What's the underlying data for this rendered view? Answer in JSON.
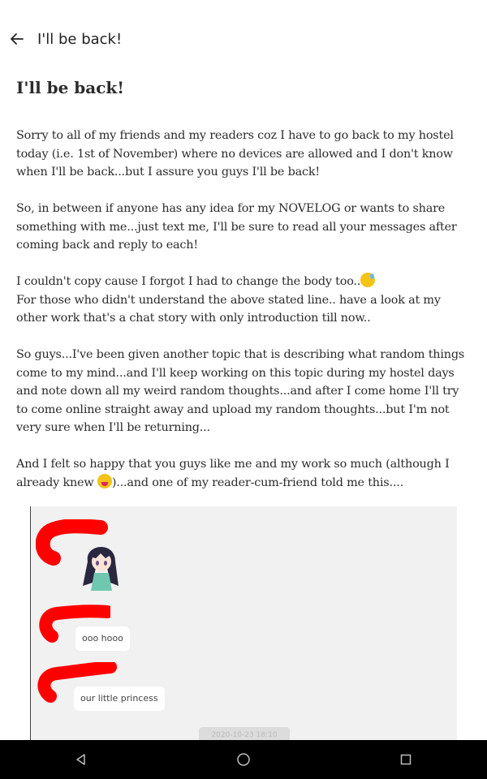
{
  "appbar": {
    "title": "I'll be back!",
    "back_icon": "arrow-left-icon"
  },
  "story": {
    "title": "I'll be back!",
    "paragraphs": [
      "Sorry to all of my friends and my readers coz I have to go back to my hostel today (i.e. 1st of November) where no devices are allowed and I don't know when I'll be back...but I assure you guys I'll be back!",
      "So, in between if anyone has any idea for my NOVELOG or wants to share something with me...just text me, I'll be sure to read all your messages after coming back and reply to each!",
      "I couldn't copy cause I forgot I had to change the body too..",
      "For those who didn't understand the above stated line.. have a look at my other work that's a chat story with only introduction till now..",
      "So guys...I've been given another topic that is describing what random things come to my mind...and I'll keep working on this topic during my hostel days and note down all my weird random thoughts...and after I come home I'll try to come online straight away and upload my random thoughts...but I'm not very sure when I'll be returning...",
      "And I felt so happy that you guys like me and my work so much (although I already knew ",
      ")...and one of my reader-cum-friend told me this...."
    ],
    "emoji_1": "sweat-smile-emoji",
    "emoji_2": "winking-tongue-emoji"
  },
  "chat_image": {
    "messages": [
      "ooo hooo",
      "our little  princess"
    ],
    "timestamp": "2020-10-23 18:10",
    "redaction_color": "#ff0000"
  },
  "navbar": {
    "icons": [
      "back-triangle-icon",
      "home-circle-icon",
      "recents-square-icon"
    ]
  }
}
